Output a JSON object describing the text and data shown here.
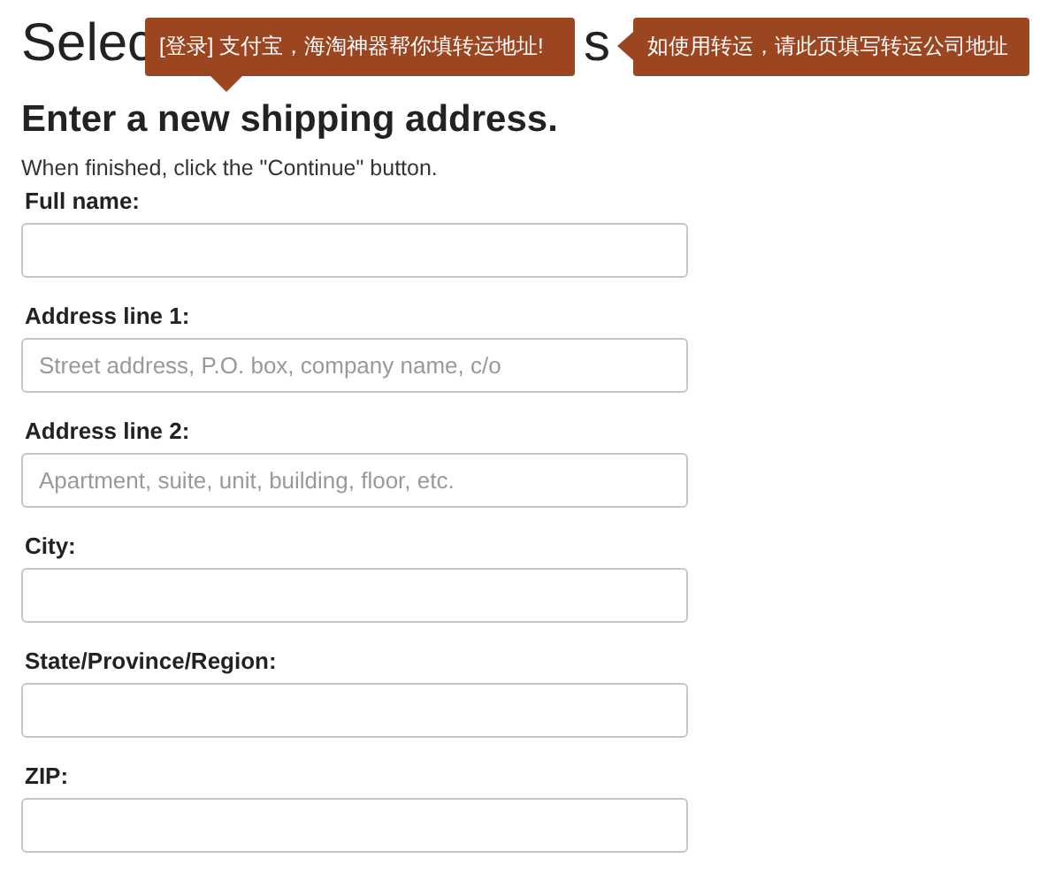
{
  "page_title": {
    "visible_start": "Selec",
    "visible_end": "s"
  },
  "tooltips": [
    {
      "text": "[登录] 支付宝，海淘神器帮你填转运地址!",
      "kind": "below"
    },
    {
      "text": "如使用转运，请此页填写转运公司地址",
      "kind": "side"
    }
  ],
  "form": {
    "heading": "Enter a new shipping address.",
    "instructions": "When finished, click the \"Continue\" button.",
    "fields": [
      {
        "label": "Full name:"
      },
      {
        "label": "Address line 1:",
        "placeholder": "Street address, P.O. box, company name, c/o"
      },
      {
        "label": "Address line 2:",
        "placeholder": "Apartment, suite, unit, building, floor, etc."
      },
      {
        "label": "City:"
      },
      {
        "label": "State/Province/Region:"
      },
      {
        "label": "ZIP:"
      }
    ]
  }
}
